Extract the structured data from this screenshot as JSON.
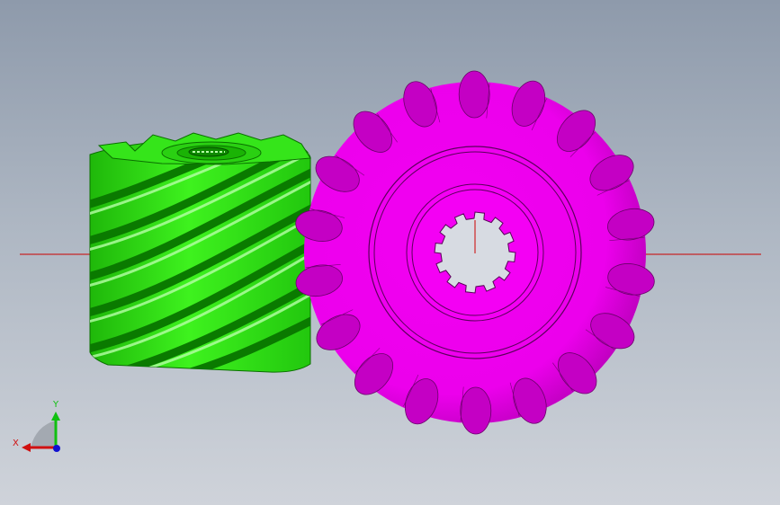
{
  "viewport": {
    "axis_labels": {
      "x": "X",
      "y": "Y"
    },
    "colors": {
      "background_top": "#8e9aab",
      "background_bottom": "#cfd3da",
      "worm_gear": "#2bdc12",
      "spur_gear": "#f200f2",
      "centerline": "#cc0000",
      "x_axis": "#d01010",
      "y_axis": "#10c010",
      "z_axis": "#1010d0"
    },
    "model": {
      "worm_gear_icon": "helical-worm-gear-icon",
      "spur_gear_icon": "spur-gear-icon"
    }
  }
}
